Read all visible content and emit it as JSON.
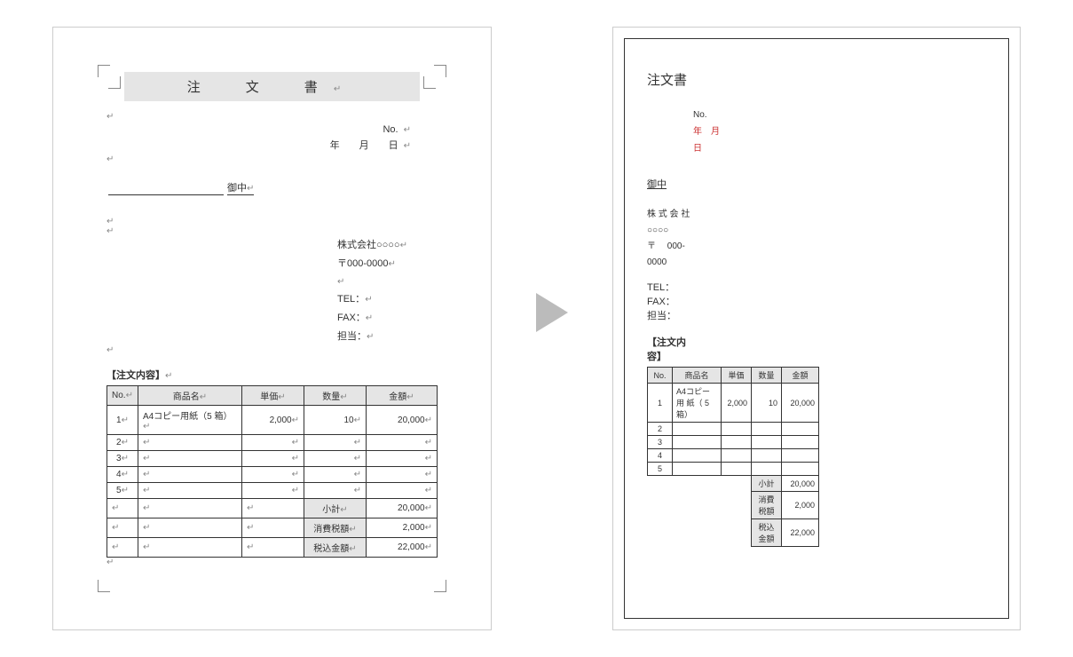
{
  "left": {
    "title": "注　文　書",
    "no_label": "No.",
    "date": "年　　月　　日",
    "onchu": "御中",
    "company": "株式会社○○○○",
    "postal": "〒000-0000",
    "tel": "TEL：",
    "fax": "FAX：",
    "staff": "担当：",
    "section": "【注文内容】",
    "headers": {
      "no": "No.",
      "name": "商品名",
      "price": "単価",
      "qty": "数量",
      "amount": "金額"
    },
    "rows": [
      {
        "no": "1",
        "name": "A4コピー用紙（5 箱）",
        "price": "2,000",
        "qty": "10",
        "amount": "20,000"
      },
      {
        "no": "2",
        "name": "",
        "price": "",
        "qty": "",
        "amount": ""
      },
      {
        "no": "3",
        "name": "",
        "price": "",
        "qty": "",
        "amount": ""
      },
      {
        "no": "4",
        "name": "",
        "price": "",
        "qty": "",
        "amount": ""
      },
      {
        "no": "5",
        "name": "",
        "price": "",
        "qty": "",
        "amount": ""
      }
    ],
    "totals": {
      "subtotal_label": "小計",
      "subtotal": "20,000",
      "tax_label": "消費税額",
      "tax": "2,000",
      "gross_label": "税込金額",
      "gross": "22,000"
    }
  },
  "right": {
    "title": "注文書",
    "no_label": "No.",
    "date_y": "年",
    "date_m": "月",
    "date_d": "日",
    "onchu": "御中",
    "company1": "株 式 会 社",
    "company2": "○○○○",
    "postal1": "〒　 000-",
    "postal2": "0000",
    "tel": "TEL：",
    "fax": "FAX：",
    "staff": "担当：",
    "section": "【注文内容】",
    "headers": {
      "no": "No.",
      "name": "商品名",
      "price": "単価",
      "qty": "数量",
      "amount": "金額"
    },
    "rows": [
      {
        "no": "1",
        "name": "A4コピー用 紙（ 5 箱）",
        "price": "2,000",
        "qty": "10",
        "amount": "20,000"
      },
      {
        "no": "2",
        "name": "",
        "price": "",
        "qty": "",
        "amount": ""
      },
      {
        "no": "3",
        "name": "",
        "price": "",
        "qty": "",
        "amount": ""
      },
      {
        "no": "4",
        "name": "",
        "price": "",
        "qty": "",
        "amount": ""
      },
      {
        "no": "5",
        "name": "",
        "price": "",
        "qty": "",
        "amount": ""
      }
    ],
    "totals": {
      "subtotal_label": "小計",
      "subtotal": "20,000",
      "tax_label": "消費税額",
      "tax": "2,000",
      "gross_label": "税込金額",
      "gross": "22,000"
    }
  }
}
